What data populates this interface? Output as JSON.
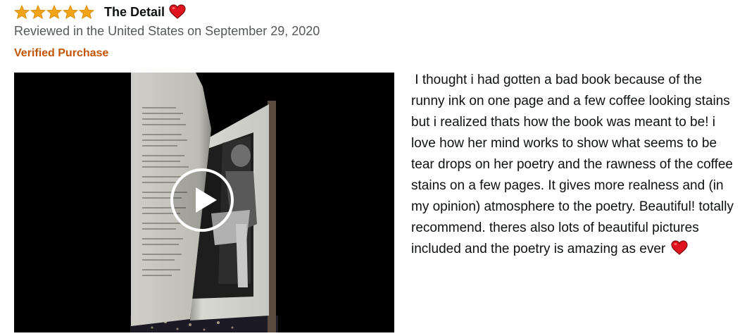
{
  "review": {
    "rating": 5,
    "rating_max": 5,
    "title": "The Detail",
    "title_icon": "heart-icon",
    "meta": "Reviewed in the United States on September 29, 2020",
    "verified_label": "Verified Purchase",
    "body": " I thought i had gotten a bad book because of the runny ink on one page and a few coffee looking stains but i realized thats how the book was meant to be! i love how her mind works to show what seems to be tear drops on her poetry and the rawness of the coffee stains on a few pages. It gives more realness and (in my opinion) atmosphere to the poetry. Beautiful! totally recommend. theres also lots of beautiful pictures included and the poetry is amazing as ever ",
    "body_end_icon": "heart-icon"
  },
  "video": {
    "play_icon": "play-icon"
  },
  "colors": {
    "star": "#f4a41b",
    "star_stroke": "#d88b06",
    "heart": "#e0141e",
    "verified": "#c45500",
    "meta": "#565959"
  }
}
